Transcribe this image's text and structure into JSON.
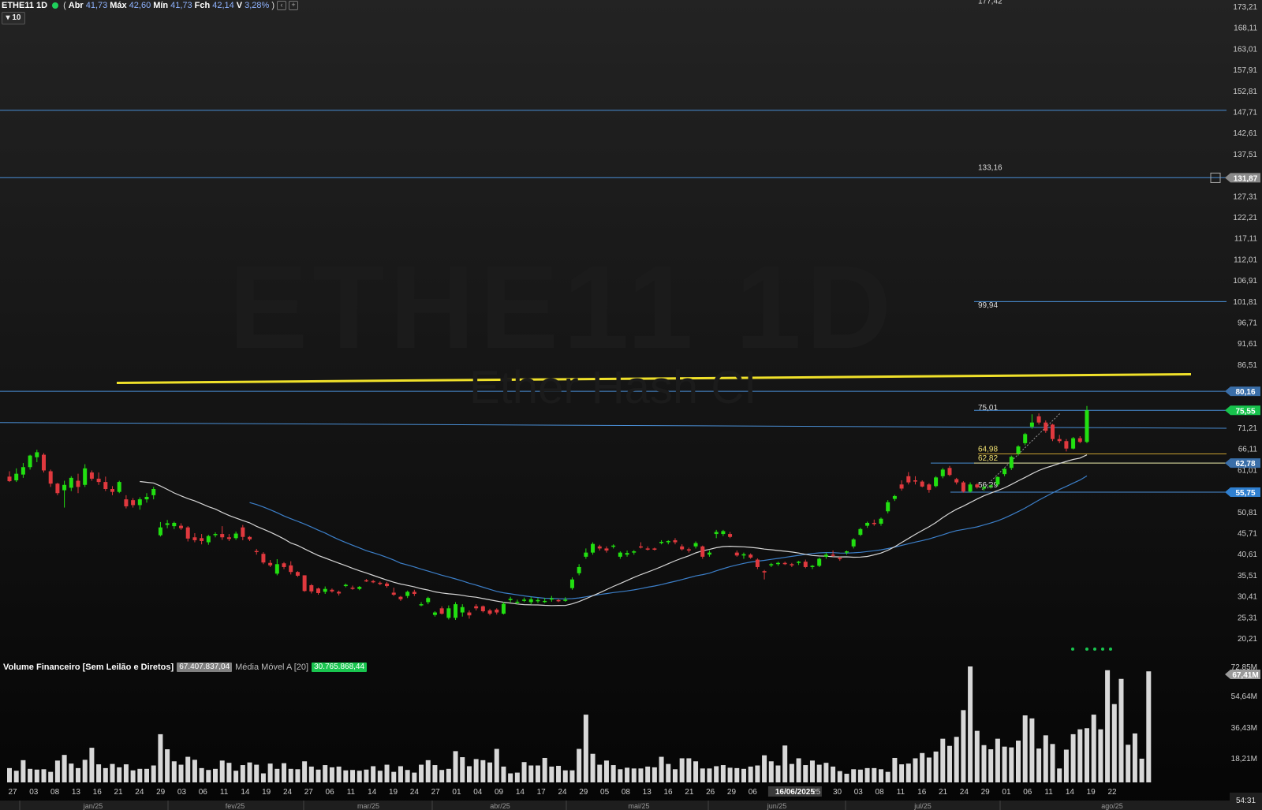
{
  "header": {
    "symbol": "ETHE11 1D",
    "open_label": "Abr",
    "open_value": "41,73",
    "max_label": "Máx",
    "max_value": "42,60",
    "min_label": "Mín",
    "min_value": "41,73",
    "close_label": "Fch",
    "close_value": "42,14",
    "var_label": "V",
    "var_value": "3,28%",
    "count_badge": "10"
  },
  "watermark": {
    "symbol": "ETHE11 1D",
    "name": "Ether Hash CI"
  },
  "price_axis": {
    "ticks": [
      "173,21",
      "168,11",
      "163,01",
      "157,91",
      "152,81",
      "147,71",
      "142,61",
      "137,51",
      "127,31",
      "122,21",
      "117,11",
      "112,01",
      "106,91",
      "101,81",
      "96,71",
      "91,61",
      "86,51",
      "71,21",
      "66,11",
      "61,01",
      "50,81",
      "45,71",
      "40,61",
      "35,51",
      "30,41",
      "25,31",
      "20,21"
    ],
    "badges": [
      {
        "text": "131,87",
        "color": "#8a8a8a"
      },
      {
        "text": "80,16",
        "color": "#3a6ea8"
      },
      {
        "text": "75,55",
        "color": "#17c24c"
      },
      {
        "text": "62,78",
        "color": "#3a6ea8"
      },
      {
        "text": "55,75",
        "color": "#2f7fcf"
      }
    ]
  },
  "level_labels": [
    "177,42",
    "133,16",
    "99,94",
    "75,01",
    "64,98",
    "62,82",
    "56,29"
  ],
  "date_axis": {
    "days": [
      "27",
      "03",
      "08",
      "13",
      "16",
      "21",
      "24",
      "29",
      "03",
      "06",
      "11",
      "14",
      "19",
      "24",
      "27",
      "06",
      "11",
      "14",
      "19",
      "24",
      "27",
      "01",
      "04",
      "09",
      "14",
      "17",
      "24",
      "29",
      "05",
      "08",
      "13",
      "16",
      "21",
      "26",
      "29",
      "06",
      "11",
      "16/06/2025",
      "25",
      "30",
      "03",
      "08",
      "11",
      "16",
      "21",
      "24",
      "29",
      "01",
      "06",
      "11",
      "14",
      "19",
      "22"
    ],
    "months": [
      "jan/25",
      "fev/25",
      "mar/25",
      "abr/25",
      "mai/25",
      "jun/25",
      "jul/25",
      "ago/25"
    ]
  },
  "volume": {
    "legend_title": "Volume Financeiro [Sem Leilão e Diretos]",
    "current_value": "67.407.837,04",
    "ma_label": "Média Móvel A [20]",
    "ma_value": "30.765.868,44",
    "axis_ticks": [
      "72,85M",
      "54,64M",
      "36,43M",
      "18,21M"
    ],
    "badge": "67,41M"
  },
  "clock": "54:31",
  "colors": {
    "up": "#22e011",
    "down": "#e0393e",
    "ma_fast": "#d6d6d6",
    "ma_slow": "#3c7fc9",
    "trendline": "#f0e12a",
    "level": "#4a8fd6"
  },
  "chart_data": {
    "type": "candlestick",
    "bars": [
      {
        "o": 59.5,
        "h": 60.8,
        "l": 58.2,
        "c": 58.4
      },
      {
        "o": 58.6,
        "h": 61.5,
        "l": 58.2,
        "c": 60.2
      },
      {
        "o": 60.0,
        "h": 62.8,
        "l": 59.2,
        "c": 61.8
      },
      {
        "o": 61.8,
        "h": 64.8,
        "l": 61.2,
        "c": 64.6
      },
      {
        "o": 64.2,
        "h": 66.0,
        "l": 63.0,
        "c": 65.4
      },
      {
        "o": 64.8,
        "h": 65.2,
        "l": 60.5,
        "c": 61.0
      },
      {
        "o": 60.8,
        "h": 61.2,
        "l": 57.0,
        "c": 57.8
      },
      {
        "o": 57.8,
        "h": 58.0,
        "l": 55.0,
        "c": 55.5
      },
      {
        "o": 56.2,
        "h": 58.5,
        "l": 52.0,
        "c": 57.5
      },
      {
        "o": 56.8,
        "h": 59.6,
        "l": 56.0,
        "c": 59.2
      },
      {
        "o": 58.5,
        "h": 60.2,
        "l": 55.5,
        "c": 57.0
      },
      {
        "o": 57.5,
        "h": 62.5,
        "l": 57.0,
        "c": 61.5
      },
      {
        "o": 60.5,
        "h": 61.0,
        "l": 58.5,
        "c": 59.0
      },
      {
        "o": 59.0,
        "h": 60.5,
        "l": 57.5,
        "c": 58.2
      },
      {
        "o": 58.2,
        "h": 59.5,
        "l": 56.0,
        "c": 56.5
      },
      {
        "o": 56.5,
        "h": 57.2,
        "l": 55.0,
        "c": 55.8
      },
      {
        "o": 55.8,
        "h": 58.5,
        "l": 55.5,
        "c": 58.2
      },
      {
        "o": 54.0,
        "h": 55.0,
        "l": 51.8,
        "c": 52.3
      },
      {
        "o": 53.8,
        "h": 54.3,
        "l": 52.0,
        "c": 52.6
      },
      {
        "o": 52.6,
        "h": 54.5,
        "l": 51.5,
        "c": 54.0
      },
      {
        "o": 54.0,
        "h": 55.5,
        "l": 53.2,
        "c": 54.6
      },
      {
        "o": 55.0,
        "h": 57.0,
        "l": 54.0,
        "c": 56.5
      },
      {
        "o": 45.3,
        "h": 48.5,
        "l": 45.0,
        "c": 47.2
      },
      {
        "o": 47.8,
        "h": 49.0,
        "l": 47.0,
        "c": 48.2
      },
      {
        "o": 47.5,
        "h": 48.6,
        "l": 46.8,
        "c": 48.3
      },
      {
        "o": 47.6,
        "h": 48.2,
        "l": 46.6,
        "c": 47.0
      },
      {
        "o": 47.2,
        "h": 47.5,
        "l": 43.8,
        "c": 44.5
      },
      {
        "o": 44.8,
        "h": 45.8,
        "l": 43.6,
        "c": 44.1
      },
      {
        "o": 44.6,
        "h": 45.6,
        "l": 43.1,
        "c": 43.9
      },
      {
        "o": 43.6,
        "h": 45.4,
        "l": 43.0,
        "c": 45.1
      },
      {
        "o": 45.4,
        "h": 46.0,
        "l": 44.8,
        "c": 45.6
      },
      {
        "o": 45.6,
        "h": 47.5,
        "l": 44.2,
        "c": 44.8
      },
      {
        "o": 44.8,
        "h": 45.6,
        "l": 43.9,
        "c": 44.4
      },
      {
        "o": 44.6,
        "h": 46.2,
        "l": 44.2,
        "c": 45.7
      },
      {
        "o": 47.2,
        "h": 47.8,
        "l": 44.1,
        "c": 44.9
      },
      {
        "o": 44.9,
        "h": 45.1,
        "l": 43.9,
        "c": 44.3
      },
      {
        "o": 41.5,
        "h": 42.0,
        "l": 40.6,
        "c": 41.3
      },
      {
        "o": 40.8,
        "h": 41.2,
        "l": 38.3,
        "c": 38.7
      },
      {
        "o": 38.6,
        "h": 39.3,
        "l": 37.6,
        "c": 38.0
      },
      {
        "o": 36.0,
        "h": 39.5,
        "l": 35.6,
        "c": 38.3
      },
      {
        "o": 38.5,
        "h": 38.8,
        "l": 37.1,
        "c": 37.6
      },
      {
        "o": 38.0,
        "h": 39.0,
        "l": 35.8,
        "c": 36.4
      },
      {
        "o": 36.4,
        "h": 36.6,
        "l": 35.2,
        "c": 35.5
      },
      {
        "o": 35.6,
        "h": 35.6,
        "l": 31.6,
        "c": 31.8
      },
      {
        "o": 33.2,
        "h": 33.5,
        "l": 31.2,
        "c": 31.7
      },
      {
        "o": 32.4,
        "h": 32.6,
        "l": 30.9,
        "c": 31.3
      },
      {
        "o": 31.6,
        "h": 32.9,
        "l": 31.1,
        "c": 32.3
      },
      {
        "o": 32.1,
        "h": 32.4,
        "l": 31.4,
        "c": 31.7
      },
      {
        "o": 31.6,
        "h": 31.9,
        "l": 30.7,
        "c": 31.2
      },
      {
        "o": 33.0,
        "h": 33.6,
        "l": 32.7,
        "c": 33.3
      },
      {
        "o": 32.6,
        "h": 33.1,
        "l": 32.1,
        "c": 32.5
      },
      {
        "o": 32.3,
        "h": 33.0,
        "l": 32.0,
        "c": 32.8
      },
      {
        "o": 34.4,
        "h": 34.7,
        "l": 34.0,
        "c": 34.2
      },
      {
        "o": 34.2,
        "h": 34.5,
        "l": 33.7,
        "c": 33.9
      },
      {
        "o": 33.8,
        "h": 34.1,
        "l": 33.2,
        "c": 33.5
      },
      {
        "o": 33.6,
        "h": 34.0,
        "l": 32.6,
        "c": 33.0
      },
      {
        "o": 31.4,
        "h": 32.6,
        "l": 30.6,
        "c": 30.9
      },
      {
        "o": 30.4,
        "h": 30.6,
        "l": 29.4,
        "c": 29.8
      },
      {
        "o": 30.6,
        "h": 31.9,
        "l": 30.1,
        "c": 31.6
      },
      {
        "o": 31.6,
        "h": 32.1,
        "l": 30.6,
        "c": 31.1
      },
      {
        "o": 28.5,
        "h": 29.1,
        "l": 28.1,
        "c": 28.6
      },
      {
        "o": 29.1,
        "h": 30.4,
        "l": 28.6,
        "c": 30.1
      },
      {
        "o": 26.0,
        "h": 26.9,
        "l": 25.6,
        "c": 26.6
      },
      {
        "o": 27.6,
        "h": 28.1,
        "l": 26.1,
        "c": 26.3
      },
      {
        "o": 25.3,
        "h": 28.3,
        "l": 24.9,
        "c": 27.6
      },
      {
        "o": 25.3,
        "h": 29.1,
        "l": 24.8,
        "c": 28.6
      },
      {
        "o": 26.6,
        "h": 28.6,
        "l": 25.6,
        "c": 27.9
      },
      {
        "o": 26.6,
        "h": 27.1,
        "l": 25.1,
        "c": 25.9
      },
      {
        "o": 28.1,
        "h": 28.6,
        "l": 27.1,
        "c": 27.6
      },
      {
        "o": 28.1,
        "h": 28.3,
        "l": 26.6,
        "c": 26.9
      },
      {
        "o": 27.1,
        "h": 27.5,
        "l": 25.9,
        "c": 26.3
      },
      {
        "o": 27.3,
        "h": 27.6,
        "l": 26.1,
        "c": 26.6
      },
      {
        "o": 26.3,
        "h": 29.1,
        "l": 26.1,
        "c": 28.7
      },
      {
        "o": 29.6,
        "h": 30.4,
        "l": 29.1,
        "c": 29.9
      },
      {
        "o": 29.1,
        "h": 29.7,
        "l": 28.6,
        "c": 29.2
      },
      {
        "o": 29.6,
        "h": 30.2,
        "l": 29.1,
        "c": 29.7
      },
      {
        "o": 29.1,
        "h": 30.4,
        "l": 28.6,
        "c": 29.8
      },
      {
        "o": 29.4,
        "h": 30.1,
        "l": 28.9,
        "c": 29.6
      },
      {
        "o": 29.4,
        "h": 30.1,
        "l": 28.9,
        "c": 29.4
      },
      {
        "o": 29.8,
        "h": 30.6,
        "l": 29.2,
        "c": 30.0
      },
      {
        "o": 29.6,
        "h": 29.9,
        "l": 29.1,
        "c": 29.4
      },
      {
        "o": 29.6,
        "h": 30.3,
        "l": 29.2,
        "c": 29.7
      },
      {
        "o": 32.5,
        "h": 35.1,
        "l": 32.1,
        "c": 34.6
      },
      {
        "o": 36.1,
        "h": 38.3,
        "l": 35.6,
        "c": 37.6
      },
      {
        "o": 40.1,
        "h": 42.1,
        "l": 39.6,
        "c": 41.1
      },
      {
        "o": 41.1,
        "h": 43.6,
        "l": 40.6,
        "c": 43.2
      },
      {
        "o": 42.6,
        "h": 43.0,
        "l": 41.6,
        "c": 42.1
      },
      {
        "o": 42.1,
        "h": 42.6,
        "l": 41.1,
        "c": 41.6
      },
      {
        "o": 42.6,
        "h": 43.1,
        "l": 42.1,
        "c": 42.8
      },
      {
        "o": 40.1,
        "h": 41.4,
        "l": 39.6,
        "c": 41.1
      },
      {
        "o": 40.6,
        "h": 41.6,
        "l": 40.1,
        "c": 41.0
      },
      {
        "o": 41.1,
        "h": 41.7,
        "l": 40.6,
        "c": 41.4
      },
      {
        "o": 42.6,
        "h": 43.6,
        "l": 42.1,
        "c": 42.4
      },
      {
        "o": 42.1,
        "h": 42.6,
        "l": 41.6,
        "c": 42.0
      },
      {
        "o": 42.1,
        "h": 42.3,
        "l": 41.6,
        "c": 41.8
      },
      {
        "o": 43.6,
        "h": 44.1,
        "l": 43.1,
        "c": 43.7
      },
      {
        "o": 43.6,
        "h": 44.1,
        "l": 43.1,
        "c": 43.9
      },
      {
        "o": 44.1,
        "h": 44.6,
        "l": 43.1,
        "c": 43.6
      },
      {
        "o": 42.6,
        "h": 43.1,
        "l": 41.6,
        "c": 41.9
      },
      {
        "o": 41.9,
        "h": 42.3,
        "l": 41.1,
        "c": 41.6
      },
      {
        "o": 42.6,
        "h": 43.8,
        "l": 42.1,
        "c": 43.4
      },
      {
        "o": 42.6,
        "h": 42.8,
        "l": 39.6,
        "c": 40.1
      },
      {
        "o": 40.6,
        "h": 41.6,
        "l": 40.1,
        "c": 41.1
      },
      {
        "o": 45.6,
        "h": 46.6,
        "l": 44.6,
        "c": 46.1
      },
      {
        "o": 45.6,
        "h": 46.6,
        "l": 45.1,
        "c": 46.3
      },
      {
        "o": 45.6,
        "h": 46.1,
        "l": 44.6,
        "c": 44.9
      },
      {
        "o": 41.1,
        "h": 41.6,
        "l": 40.1,
        "c": 40.4
      },
      {
        "o": 40.4,
        "h": 41.1,
        "l": 39.6,
        "c": 40.7
      },
      {
        "o": 40.6,
        "h": 40.9,
        "l": 39.6,
        "c": 39.9
      },
      {
        "o": 39.4,
        "h": 39.7,
        "l": 37.1,
        "c": 37.6
      },
      {
        "o": 36.6,
        "h": 36.9,
        "l": 34.6,
        "c": 36.3
      },
      {
        "o": 38.1,
        "h": 38.6,
        "l": 37.6,
        "c": 38.3
      },
      {
        "o": 38.4,
        "h": 38.9,
        "l": 37.9,
        "c": 38.6
      },
      {
        "o": 38.6,
        "h": 38.9,
        "l": 38.1,
        "c": 38.3
      },
      {
        "o": 38.3,
        "h": 38.6,
        "l": 37.6,
        "c": 38.1
      },
      {
        "o": 38.6,
        "h": 39.1,
        "l": 38.1,
        "c": 38.9
      },
      {
        "o": 38.9,
        "h": 39.4,
        "l": 37.3,
        "c": 37.6
      },
      {
        "o": 37.6,
        "h": 38.1,
        "l": 37.1,
        "c": 37.9
      },
      {
        "o": 37.9,
        "h": 39.9,
        "l": 37.6,
        "c": 39.6
      },
      {
        "o": 40.1,
        "h": 41.1,
        "l": 39.6,
        "c": 40.6
      },
      {
        "o": 40.6,
        "h": 41.6,
        "l": 40.1,
        "c": 40.4
      },
      {
        "o": 39.8,
        "h": 40.1,
        "l": 39.1,
        "c": 39.6
      },
      {
        "o": 41.1,
        "h": 41.6,
        "l": 40.6,
        "c": 41.4
      },
      {
        "o": 42.6,
        "h": 44.6,
        "l": 42.1,
        "c": 44.3
      },
      {
        "o": 45.4,
        "h": 47.1,
        "l": 45.1,
        "c": 46.8
      },
      {
        "o": 47.6,
        "h": 48.6,
        "l": 47.1,
        "c": 48.3
      },
      {
        "o": 48.3,
        "h": 49.1,
        "l": 47.6,
        "c": 48.0
      },
      {
        "o": 48.1,
        "h": 49.6,
        "l": 47.6,
        "c": 49.3
      },
      {
        "o": 51.1,
        "h": 53.8,
        "l": 50.6,
        "c": 53.3
      },
      {
        "o": 54.1,
        "h": 55.1,
        "l": 53.6,
        "c": 54.8
      },
      {
        "o": 57.6,
        "h": 58.6,
        "l": 56.1,
        "c": 56.6
      },
      {
        "o": 59.6,
        "h": 60.6,
        "l": 57.6,
        "c": 58.1
      },
      {
        "o": 58.6,
        "h": 59.6,
        "l": 57.6,
        "c": 58.3
      },
      {
        "o": 58.3,
        "h": 58.6,
        "l": 56.9,
        "c": 57.1
      },
      {
        "o": 57.6,
        "h": 57.9,
        "l": 55.6,
        "c": 56.3
      },
      {
        "o": 57.2,
        "h": 59.6,
        "l": 56.9,
        "c": 59.3
      },
      {
        "o": 59.6,
        "h": 61.6,
        "l": 59.1,
        "c": 61.2
      },
      {
        "o": 61.6,
        "h": 62.1,
        "l": 59.6,
        "c": 59.9
      },
      {
        "o": 58.9,
        "h": 59.2,
        "l": 57.6,
        "c": 58.1
      },
      {
        "o": 58.1,
        "h": 58.4,
        "l": 55.6,
        "c": 55.9
      },
      {
        "o": 55.9,
        "h": 58.1,
        "l": 55.6,
        "c": 57.6
      },
      {
        "o": 57.6,
        "h": 57.9,
        "l": 56.6,
        "c": 56.9
      },
      {
        "o": 56.6,
        "h": 57.4,
        "l": 56.1,
        "c": 56.9
      },
      {
        "o": 57.1,
        "h": 57.6,
        "l": 56.6,
        "c": 57.4
      },
      {
        "o": 57.6,
        "h": 59.6,
        "l": 57.1,
        "c": 59.4
      },
      {
        "o": 60.1,
        "h": 61.6,
        "l": 59.6,
        "c": 61.4
      },
      {
        "o": 61.6,
        "h": 64.6,
        "l": 61.1,
        "c": 64.3
      },
      {
        "o": 65.1,
        "h": 67.1,
        "l": 64.6,
        "c": 66.8
      },
      {
        "o": 67.6,
        "h": 70.1,
        "l": 67.1,
        "c": 69.8
      },
      {
        "o": 71.6,
        "h": 74.6,
        "l": 71.1,
        "c": 72.6
      },
      {
        "o": 74.1,
        "h": 74.8,
        "l": 72.1,
        "c": 72.6
      },
      {
        "o": 72.6,
        "h": 73.1,
        "l": 70.1,
        "c": 70.6
      },
      {
        "o": 72.1,
        "h": 72.3,
        "l": 68.1,
        "c": 68.6
      },
      {
        "o": 68.6,
        "h": 69.6,
        "l": 67.6,
        "c": 68.1
      },
      {
        "o": 68.1,
        "h": 68.6,
        "l": 65.6,
        "c": 66.3
      },
      {
        "o": 66.3,
        "h": 69.1,
        "l": 66.1,
        "c": 68.8
      },
      {
        "o": 68.8,
        "h": 69.3,
        "l": 67.6,
        "c": 67.9
      },
      {
        "o": 67.9,
        "h": 76.6,
        "l": 67.6,
        "c": 75.55
      }
    ],
    "volume_m": [
      3.8,
      3.1,
      5.9,
      3.6,
      3.4,
      3.5,
      2.8,
      5.8,
      7.3,
      5.0,
      3.8,
      6.0,
      9.2,
      4.8,
      3.8,
      4.9,
      4.0,
      4.8,
      3.2,
      3.6,
      3.6,
      4.5,
      12.8,
      8.8,
      5.6,
      4.7,
      6.8,
      6.0,
      3.8,
      3.3,
      3.6,
      5.8,
      5.2,
      3.1,
      4.6,
      5.3,
      4.7,
      2.4,
      5.0,
      3.6,
      5.1,
      3.6,
      3.5,
      5.6,
      4.2,
      3.4,
      4.6,
      4.0,
      4.2,
      3.2,
      3.3,
      3.1,
      3.4,
      4.3,
      3.1,
      4.7,
      2.8,
      4.3,
      3.3,
      2.6,
      4.7,
      5.9,
      4.6,
      3.3,
      3.6,
      8.3,
      6.7,
      4.3,
      6.2,
      5.9,
      5.3,
      8.9,
      4.2,
      2.4,
      2.6,
      5.4,
      4.5,
      4.5,
      6.5,
      4.2,
      4.4,
      3.2,
      3.2,
      8.9,
      18.0,
      7.6,
      4.7,
      5.8,
      4.6,
      3.5,
      3.9,
      3.7,
      3.7,
      4.2,
      4.0,
      6.8,
      4.9,
      3.5,
      6.4,
      6.4,
      5.6,
      3.7,
      3.7,
      4.3,
      4.6,
      3.9,
      3.8,
      3.6,
      4.2,
      4.5,
      7.2,
      5.6,
      4.5,
      9.8,
      4.9,
      6.4,
      4.6,
      5.8,
      4.7,
      5.2,
      4.2,
      3.0,
      2.3,
      3.5,
      3.4,
      3.8,
      3.8,
      3.5,
      2.8,
      6.5,
      4.8,
      5.0,
      6.4,
      7.8,
      6.6,
      8.2,
      11.6,
      9.7,
      12.1,
      19.2,
      30.8,
      13.7,
      9.9,
      8.8,
      11.6,
      9.5,
      9.3,
      11.1,
      17.8,
      17.0,
      9.0,
      12.5,
      10.2,
      3.7,
      8.7,
      12.8,
      14.1,
      14.4,
      18.0,
      14.1,
      29.8,
      20.8,
      27.5,
      10.0,
      13.0,
      6.3,
      29.5
    ]
  }
}
